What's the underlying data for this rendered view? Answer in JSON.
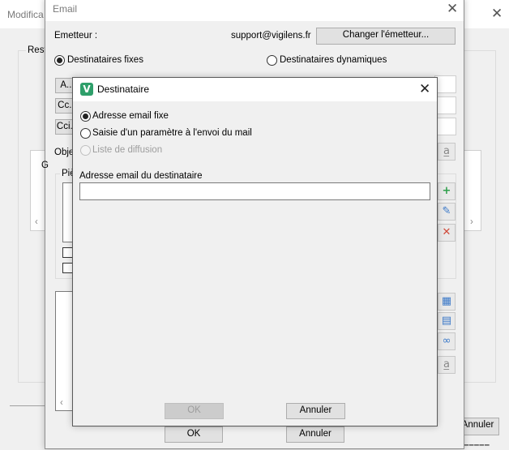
{
  "background_window": {
    "title": "Modifica",
    "label_left": "Resti",
    "cancel_label": "Annuler",
    "bottom_partial_text": "— — —"
  },
  "email_window": {
    "title": "Email",
    "emetteur_label": "Emetteur :",
    "emetteur_value": "support@vigilens.fr",
    "change_sender_label": "Changer l'émetteur...",
    "radio_fixed_label": "Destinataires fixes",
    "radio_dynamic_label": "Destinataires dynamiques",
    "to_button": "A...",
    "cc_button": "Cc...",
    "cci_button": "Cci...",
    "object_label": "Obje",
    "attachments_label": "Piè",
    "group_label": "G",
    "ok_label": "OK",
    "cancel_label": "Annuler"
  },
  "dialog": {
    "title": "Destinataire",
    "logo_letter": "V",
    "options": [
      {
        "label": "Adresse email fixe",
        "selected": true,
        "disabled": false
      },
      {
        "label": "Saisie d'un paramètre à l'envoi du mail",
        "selected": false,
        "disabled": false
      },
      {
        "label": "Liste de diffusion",
        "selected": false,
        "disabled": true
      }
    ],
    "email_field_label": "Adresse email du destinataire",
    "email_field_value": "",
    "ok_label": "OK",
    "cancel_label": "Annuler"
  }
}
